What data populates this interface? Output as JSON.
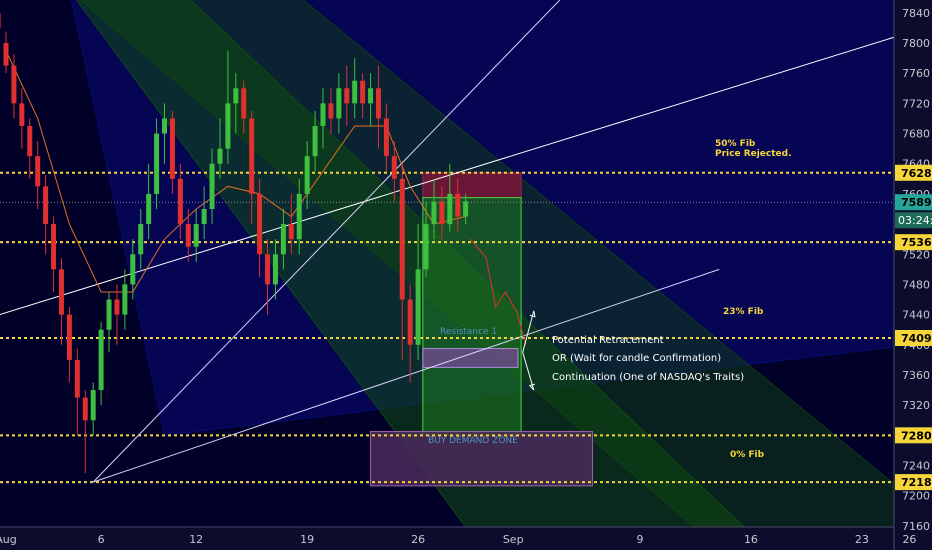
{
  "chart_data": {
    "type": "candlestick",
    "instrument_note": "NASDAQ",
    "y_ticks": [
      7160,
      7200,
      7240,
      7280,
      7320,
      7360,
      7400,
      7440,
      7480,
      7520,
      7560,
      7600,
      7640,
      7680,
      7720,
      7760,
      7800,
      7840
    ],
    "y_range": [
      7128,
      7857
    ],
    "x_ticks": [
      {
        "label": "Aug",
        "day": 0
      },
      {
        "label": "6",
        "day": 6
      },
      {
        "label": "12",
        "day": 12
      },
      {
        "label": "19",
        "day": 19
      },
      {
        "label": "26",
        "day": 26
      },
      {
        "label": "Sep",
        "day": 32
      },
      {
        "label": "9",
        "day": 40
      },
      {
        "label": "16",
        "day": 47
      },
      {
        "label": "23",
        "day": 54
      },
      {
        "label": "26",
        "day": 57
      }
    ],
    "price_levels": [
      {
        "value": 7628,
        "label": "7628",
        "badge_color": "#f5d53a",
        "dashed": true
      },
      {
        "value": 7589,
        "label": "7589",
        "badge_color": "#26a69a",
        "dashed": false
      },
      {
        "value": 7536,
        "label": "7536",
        "badge_color": "#f5d53a",
        "dashed": true
      },
      {
        "value": 7409,
        "label": "7409",
        "badge_color": "#f5d53a",
        "dashed": true
      },
      {
        "value": 7280,
        "label": "7280",
        "badge_color": "#f5d53a",
        "dashed": true
      },
      {
        "value": 7218,
        "label": "7218",
        "badge_color": "#f5d53a",
        "dashed": true
      }
    ],
    "countdown": "03:24:2",
    "annotations": {
      "fib50": [
        "50% Fib",
        "Price Rejected."
      ],
      "fib23": "23% Fib",
      "fib0": "0% Fib",
      "resistance": "Resistance 1",
      "demand": "BUY DEMAND ZONE",
      "notes": [
        "Potential Retracement",
        "OR (Wait for candle Confirmation)",
        "Continuation (One of NASDAQ's Traits)"
      ]
    },
    "zones": {
      "stop": {
        "day_from": 26.3,
        "day_to": 32.5,
        "top": 7628,
        "bottom": 7595
      },
      "target": {
        "day_from": 26.3,
        "day_to": 32.5,
        "top": 7595,
        "bottom": 7280
      },
      "resistance": {
        "day_from": 26.3,
        "day_to": 32.3,
        "top": 7395,
        "bottom": 7370
      },
      "demand": {
        "day_from": 23.0,
        "day_to": 37.0,
        "top": 7285,
        "bottom": 7213
      }
    },
    "candles": [
      [
        -0.5,
        7840,
        7820,
        7850,
        7810
      ],
      [
        0.0,
        7800,
        7770,
        7815,
        7760
      ],
      [
        0.5,
        7770,
        7720,
        7785,
        7700
      ],
      [
        1.0,
        7720,
        7690,
        7740,
        7660
      ],
      [
        1.5,
        7690,
        7650,
        7700,
        7620
      ],
      [
        2.0,
        7650,
        7610,
        7670,
        7580
      ],
      [
        2.5,
        7610,
        7560,
        7625,
        7520
      ],
      [
        3.0,
        7560,
        7500,
        7570,
        7470
      ],
      [
        3.5,
        7500,
        7440,
        7515,
        7400
      ],
      [
        4.0,
        7440,
        7380,
        7450,
        7350
      ],
      [
        4.5,
        7380,
        7330,
        7395,
        7280
      ],
      [
        5.0,
        7330,
        7300,
        7340,
        7230
      ],
      [
        5.5,
        7300,
        7340,
        7350,
        7280
      ],
      [
        6.0,
        7340,
        7420,
        7430,
        7320
      ],
      [
        6.5,
        7420,
        7460,
        7470,
        7390
      ],
      [
        7.0,
        7460,
        7440,
        7480,
        7400
      ],
      [
        7.5,
        7440,
        7480,
        7500,
        7420
      ],
      [
        8.0,
        7480,
        7520,
        7540,
        7460
      ],
      [
        8.5,
        7520,
        7560,
        7580,
        7500
      ],
      [
        9.0,
        7560,
        7600,
        7640,
        7540
      ],
      [
        9.5,
        7600,
        7680,
        7700,
        7580
      ],
      [
        10.0,
        7680,
        7700,
        7720,
        7640
      ],
      [
        10.5,
        7700,
        7620,
        7710,
        7600
      ],
      [
        11.0,
        7620,
        7560,
        7640,
        7540
      ],
      [
        11.5,
        7560,
        7530,
        7580,
        7510
      ],
      [
        12.0,
        7530,
        7560,
        7580,
        7510
      ],
      [
        12.5,
        7560,
        7580,
        7610,
        7540
      ],
      [
        13.0,
        7580,
        7640,
        7660,
        7560
      ],
      [
        13.5,
        7640,
        7660,
        7700,
        7620
      ],
      [
        14.0,
        7660,
        7720,
        7790,
        7640
      ],
      [
        14.5,
        7720,
        7740,
        7760,
        7680
      ],
      [
        15.0,
        7740,
        7700,
        7750,
        7680
      ],
      [
        15.5,
        7700,
        7600,
        7710,
        7560
      ],
      [
        16.0,
        7600,
        7520,
        7620,
        7490
      ],
      [
        16.5,
        7520,
        7480,
        7540,
        7440
      ],
      [
        17.0,
        7480,
        7520,
        7540,
        7460
      ],
      [
        17.5,
        7520,
        7560,
        7580,
        7500
      ],
      [
        18.0,
        7560,
        7540,
        7600,
        7520
      ],
      [
        18.5,
        7540,
        7600,
        7620,
        7520
      ],
      [
        19.0,
        7600,
        7650,
        7670,
        7580
      ],
      [
        19.5,
        7650,
        7690,
        7710,
        7630
      ],
      [
        20.0,
        7690,
        7720,
        7740,
        7660
      ],
      [
        20.5,
        7720,
        7700,
        7740,
        7680
      ],
      [
        21.0,
        7700,
        7740,
        7760,
        7680
      ],
      [
        21.5,
        7740,
        7720,
        7770,
        7690
      ],
      [
        22.0,
        7720,
        7750,
        7780,
        7700
      ],
      [
        22.5,
        7750,
        7720,
        7760,
        7700
      ],
      [
        23.0,
        7720,
        7740,
        7760,
        7690
      ],
      [
        23.5,
        7740,
        7700,
        7770,
        7660
      ],
      [
        24.0,
        7700,
        7650,
        7720,
        7630
      ],
      [
        24.5,
        7650,
        7620,
        7670,
        7590
      ],
      [
        25.0,
        7620,
        7460,
        7640,
        7380
      ],
      [
        25.5,
        7460,
        7400,
        7480,
        7350
      ],
      [
        26.0,
        7400,
        7500,
        7560,
        7380
      ],
      [
        26.5,
        7500,
        7560,
        7590,
        7490
      ],
      [
        27.0,
        7560,
        7590,
        7620,
        7540
      ],
      [
        27.5,
        7590,
        7560,
        7610,
        7540
      ],
      [
        28.0,
        7560,
        7600,
        7640,
        7550
      ],
      [
        28.5,
        7600,
        7570,
        7620,
        7550
      ],
      [
        29.0,
        7570,
        7590,
        7600,
        7560
      ]
    ],
    "ma_line": [
      [
        0,
        7790
      ],
      [
        2,
        7700
      ],
      [
        4,
        7560
      ],
      [
        6,
        7470
      ],
      [
        8,
        7470
      ],
      [
        10,
        7540
      ],
      [
        12,
        7580
      ],
      [
        14,
        7610
      ],
      [
        16,
        7600
      ],
      [
        18,
        7570
      ],
      [
        20,
        7630
      ],
      [
        22,
        7690
      ],
      [
        24,
        7690
      ],
      [
        25.5,
        7610
      ],
      [
        27,
        7560
      ],
      [
        29,
        7570
      ]
    ],
    "projection_path": [
      [
        29.3,
        7540
      ],
      [
        30.3,
        7515
      ],
      [
        30.9,
        7450
      ],
      [
        31.5,
        7470
      ],
      [
        32.2,
        7445
      ],
      [
        32.8,
        7400
      ]
    ],
    "arrows": [
      {
        "from": [
          32.6,
          7390
        ],
        "to": [
          33.3,
          7445
        ]
      },
      {
        "from": [
          32.6,
          7390
        ],
        "to": [
          33.3,
          7340
        ]
      }
    ],
    "trendlines": [
      {
        "from": [
          -5,
          7410
        ],
        "to": [
          61,
          7840
        ],
        "color": "#ffffff"
      },
      {
        "from": [
          5.5,
          7218
        ],
        "to": [
          45,
          7500
        ],
        "color": "#d9d2ff"
      },
      {
        "from": [
          5.5,
          7218
        ],
        "to": [
          36,
          7880
        ],
        "color": "#d9d2ff"
      }
    ],
    "fans": [
      {
        "points": [
          [
            4,
            7870
          ],
          [
            61,
            7870
          ],
          [
            61,
            7410
          ],
          [
            10,
            7280
          ]
        ],
        "color": "#0a0a78"
      },
      {
        "points": [
          [
            4,
            7870
          ],
          [
            18,
            7870
          ],
          [
            61,
            7130
          ],
          [
            45,
            7130
          ]
        ],
        "color": "#0e3a16"
      },
      {
        "points": [
          [
            4,
            7870
          ],
          [
            11,
            7870
          ],
          [
            48,
            7130
          ],
          [
            30,
            7130
          ]
        ],
        "color": "#0f4a12"
      }
    ]
  }
}
